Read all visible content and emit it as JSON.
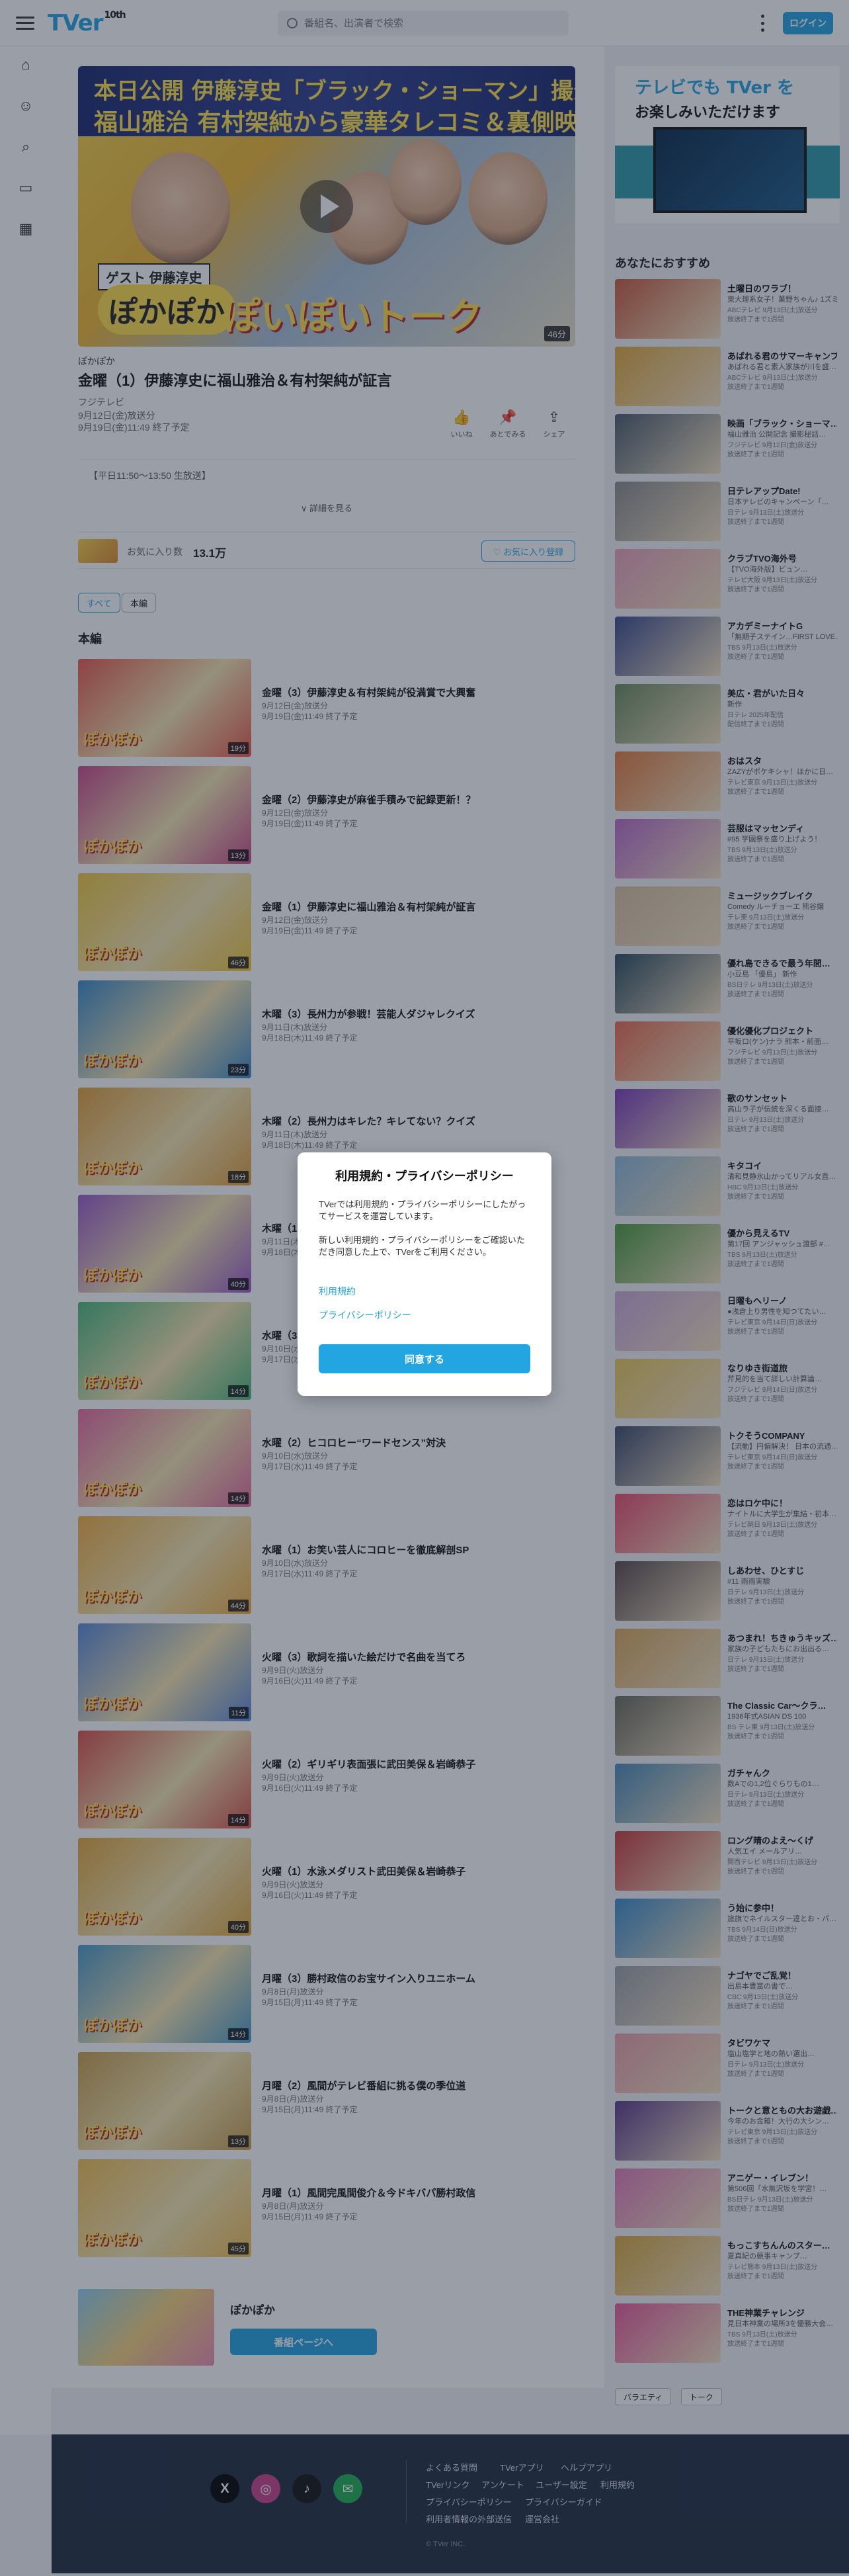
{
  "header": {
    "logo": "TVer",
    "logo_badge": "10th",
    "search_placeholder": "番組名、出演者で検索",
    "login_label": "ログイン"
  },
  "hero": {
    "line1": "本日公開 伊藤淳史「ブラック・ショーマン」撮影現場の裏側",
    "line2": "福山雅治 有村架純から豪華タレコミ＆裏側映SP",
    "guest_label": "ゲスト 伊藤淳史",
    "show_label": "ぽかぽか",
    "talk_label": "ぽいぽいトーク",
    "duration": "46分"
  },
  "episode": {
    "series": "ぽかぽか",
    "title": "金曜（1）伊藤淳史に福山雅治＆有村架純が証言",
    "broadcaster": "フジテレビ",
    "aired": "9月12日(金)放送分",
    "expires": "9月19日(金)11:49 終了予定",
    "actions": [
      {
        "icon": "thumb-icon",
        "glyph": "👍",
        "label": "いいね"
      },
      {
        "icon": "pin-icon",
        "glyph": "📌",
        "label": "あとでみる"
      },
      {
        "icon": "share-icon",
        "glyph": "⇪",
        "label": "シェア"
      }
    ],
    "description": "【平日11:50～13:50 生放送】",
    "more_label": "∨ 詳細を見る"
  },
  "favorite": {
    "label": "お気に入り数",
    "count": "13.1万",
    "button": "♡ お気に入り登録"
  },
  "filters": [
    "すべて",
    "本編"
  ],
  "section_title": "本編",
  "episodes": [
    {
      "title": "金曜（3）伊藤淳史＆有村架純が役満賞で大興奮",
      "aired": "9月12日(金)放送分",
      "expires": "9月19日(金)11:49 終了予定",
      "dur": "19分"
    },
    {
      "title": "金曜（2）伊藤淳史が麻雀手積みで記録更新！？",
      "aired": "9月12日(金)放送分",
      "expires": "9月19日(金)11:49 終了予定",
      "dur": "13分"
    },
    {
      "title": "金曜（1）伊藤淳史に福山雅治＆有村架純が証言",
      "aired": "9月12日(金)放送分",
      "expires": "9月19日(金)11:49 終了予定",
      "dur": "46分"
    },
    {
      "title": "木曜（3）長州力が参戦！芸能人ダジャレクイズ",
      "aired": "9月11日(木)放送分",
      "expires": "9月18日(木)11:49 終了予定",
      "dur": "23分"
    },
    {
      "title": "木曜（2）長州力はキレた？キレてない？クイズ",
      "aired": "9月11日(木)放送分",
      "expires": "9月18日(木)11:49 終了予定",
      "dur": "18分"
    },
    {
      "title": "木曜（1）",
      "aired": "9月11日(木)放送分",
      "expires": "9月18日(木)11:49 終了予定",
      "dur": "40分"
    },
    {
      "title": "水曜（3）",
      "aired": "9月10日(水)放送分",
      "expires": "9月17日(水)11:49 終了予定",
      "dur": "14分"
    },
    {
      "title": "水曜（2）ヒコロヒー“ワードセンス”対決",
      "aired": "9月10日(水)放送分",
      "expires": "9月17日(水)11:49 終了予定",
      "dur": "14分"
    },
    {
      "title": "水曜（1）お笑い芸人にコロヒーを徹底解剖SP",
      "aired": "9月10日(水)放送分",
      "expires": "9月17日(水)11:49 終了予定",
      "dur": "44分"
    },
    {
      "title": "火曜（3）歌詞を描いた絵だけで名曲を当てろ",
      "aired": "9月9日(火)放送分",
      "expires": "9月16日(火)11:49 終了予定",
      "dur": "11分"
    },
    {
      "title": "火曜（2）ギリギリ表面張に武田美保＆岩崎恭子",
      "aired": "9月9日(火)放送分",
      "expires": "9月16日(火)11:49 終了予定",
      "dur": "14分"
    },
    {
      "title": "火曜（1）水泳メダリスト武田美保＆岩崎恭子",
      "aired": "9月9日(火)放送分",
      "expires": "9月16日(火)11:49 終了予定",
      "dur": "40分"
    },
    {
      "title": "月曜（3）勝村政信のお宝サイン入りユニホーム",
      "aired": "9月8日(月)放送分",
      "expires": "9月15日(月)11:49 終了予定",
      "dur": "14分"
    },
    {
      "title": "月曜（2）風間がテレビ番組に挑る僕の季位道",
      "aired": "9月8日(月)放送分",
      "expires": "9月15日(月)11:49 終了予定",
      "dur": "13分"
    },
    {
      "title": "月曜（1）風間完風間俊介＆今ドキバパ勝村政信",
      "aired": "9月8日(月)放送分",
      "expires": "9月15日(月)11:49 終了予定",
      "dur": "45分"
    }
  ],
  "program": {
    "name": "ぽかぽか",
    "button": "番組ページへ"
  },
  "side": {
    "banner_line1": "テレビでも TVer を",
    "banner_line2": "お楽しみいただけます",
    "section_title": "あなたにおすすめ",
    "recommendations": [
      {
        "name": "土曜日のワラブ！",
        "sub": "東大理系女子！菓野ちゃん♪ 1ズミ…",
        "ch": "ABCテレビ 9月13日(土)放送分",
        "exp": "放送終了まで1週間",
        "c": "#c85a3a"
      },
      {
        "name": "あばれる君のサマーキャンプ",
        "sub": "あばれる君と素人家族が川を盛…",
        "ch": "ABCテレビ 9月13日(土)放送分",
        "exp": "放送終了まで1週間",
        "c": "#e0a83a"
      },
      {
        "name": "映画「ブラック・ショーマ…",
        "sub": "福山雅治 公開記念 撮影秘話…",
        "ch": "フジテレビ 9月12日(金)放送分",
        "exp": "放送終了まで1週間",
        "c": "#4a5a6a"
      },
      {
        "name": "日テレアップDate!",
        "sub": "日本テレビのキャンペーン「…",
        "ch": "日テレ 9月13日(土)放送分",
        "exp": "放送終了まで1週間",
        "c": "#8a8a8a"
      },
      {
        "name": "クラブTVO海外号",
        "sub": "【TVO海外版】ビュン…",
        "ch": "テレビ大阪 9月13日(土)放送分",
        "exp": "放送終了まで1週間",
        "c": "#e8a0b8"
      },
      {
        "name": "アカデミーナイトG",
        "sub": "「無期子ステイン…FIRST LOVE…",
        "ch": "TBS 9月13日(土)放送分",
        "exp": "放送終了まで1週間",
        "c": "#3a4a8a"
      },
      {
        "name": "美広・君がいた日々",
        "sub": "新作",
        "ch": "日テレ 2025年配信",
        "exp": "配信終了まで1週間",
        "c": "#6a8a5a"
      },
      {
        "name": "おはスタ",
        "sub": "ZAZYがポケキシャ！ほかに日…",
        "ch": "テレビ東京 9月13日(土)放送分",
        "exp": "放送終了まで1週間",
        "c": "#e07a3a"
      },
      {
        "name": "芸服はマッセンディ",
        "sub": "#95 学園祭を盛り上げよう！",
        "ch": "TBS 9月13日(土)放送分",
        "exp": "放送終了まで1週間",
        "c": "#b86ac8"
      },
      {
        "name": "ミュージックブレイク",
        "sub": "Comedy ルーチョーエ 熊谷嬢",
        "ch": "テレ東 9月13日(土)放送分",
        "exp": "放送終了まで1週間",
        "c": "#d8c0a0"
      },
      {
        "name": "優れ島できるで最う年間…",
        "sub": "小豆島 「優島」 新作",
        "ch": "BS日テレ 9月13日(土)放送分",
        "exp": "放送終了まで1週間",
        "c": "#2a4a5a"
      },
      {
        "name": "優化優化プロジェクト",
        "sub": "平坂ロ(ケン)ナラ 熊本・前面…",
        "ch": "フジテレビ 9月13日(土)放送分",
        "exp": "放送終了まで1週間",
        "c": "#e86a4a"
      },
      {
        "name": "歌のサンセット",
        "sub": "高山ラ子が伝統を深くる面接…",
        "ch": "日テレ 9月13日(土)放送分",
        "exp": "放送終了まで1週間",
        "c": "#7a3ab8"
      },
      {
        "name": "キタコイ",
        "sub": "清和見静氷山かってリアル女直…",
        "ch": "HBC 9月13日(土)放送分",
        "exp": "放送終了まで1週間",
        "c": "#8ab8d8"
      },
      {
        "name": "優から見えるTV",
        "sub": "第17回 アンジャッシュ渡部 #…",
        "ch": "TBS 9月13日(土)放送分",
        "exp": "放送終了まで1週間",
        "c": "#4a9a3a"
      },
      {
        "name": "日曜もヘリーノ",
        "sub": "●浅倉上り男性を知つてたい…",
        "ch": "テレビ東京 9月14日(日)放送分",
        "exp": "放送終了まで1週間",
        "c": "#c8a8d8"
      },
      {
        "name": "なりゆき街道旅",
        "sub": "芹見的を当て詳しい計算論…",
        "ch": "フジテレビ 9月14日(日)放送分",
        "exp": "放送終了まで1週間",
        "c": "#e8c85a"
      },
      {
        "name": "トクそうCOMPANY",
        "sub": "【流動】円偏解決！ 日本の流通…",
        "ch": "テレビ東京 9月14日(日)放送分",
        "exp": "放送終了まで1週間",
        "c": "#3a4a6a"
      },
      {
        "name": "恋はロケ中に！",
        "sub": "ナイトルに大学生が集結・初本…",
        "ch": "テレビ朝日 9月13日(土)放送分",
        "exp": "放送終了まで1週間",
        "c": "#e84a6a"
      },
      {
        "name": "しあわせ、ひとすじ",
        "sub": "#11 雨雨実験",
        "ch": "日テレ 9月13日(土)放送分",
        "exp": "放送終了まで1週間",
        "c": "#5a4a4a"
      },
      {
        "name": "あつまれ！ちきゅうキッズ…",
        "sub": "家族の子どもたちにお出出る…",
        "ch": "日テレ 9月13日(土)放送分",
        "exp": "放送終了まで1週間",
        "c": "#d8a85a"
      },
      {
        "name": "The Classic Car〜クラ…",
        "sub": "1936年式ASIAN DS 100",
        "ch": "BS テレ東 9月13日(土)放送分",
        "exp": "放送終了まで1週間",
        "c": "#6a6a5a"
      },
      {
        "name": "ガチャんク",
        "sub": "数Aでの1,2位ぐらりもの1…",
        "ch": "日テレ 9月13日(土)放送分",
        "exp": "放送終了まで1週間",
        "c": "#4a8ab8"
      },
      {
        "name": "ロング晴のよえ〜くげ",
        "sub": "人気エイ メールアリ…",
        "ch": "関西テレビ 9月13日(土)放送分",
        "exp": "放送終了まで1週間",
        "c": "#c83a3a"
      },
      {
        "name": "う始に参中！",
        "sub": "旅旗でネイルスター達とお・パ…",
        "ch": "TBS 9月14日(日)放送分",
        "exp": "放送終了まで1週間",
        "c": "#3a8ac8"
      },
      {
        "name": "ナゴヤでご乱覚！",
        "sub": "出島本豊富の書で…",
        "ch": "CBC 9月13日(土)放送分",
        "exp": "放送終了まで1週間",
        "c": "#9aa0a8"
      },
      {
        "name": "タビワケマ",
        "sub": "塩山塩学と地の熱い選出…",
        "ch": "日テレ 9月13日(土)放送分",
        "exp": "放送終了まで1週間",
        "c": "#e8a0a8"
      },
      {
        "name": "トークと意ともの大お遊戯…",
        "sub": "今年のお金箱！大行の大シン…",
        "ch": "テレビ東京 9月13日(土)放送分",
        "exp": "放送終了まで1週間",
        "c": "#5a3a8a"
      },
      {
        "name": "アニゲー・イレブン！",
        "sub": "第506回「水無沢坂を学宮！…",
        "ch": "BS日テレ 9月13日(土)放送分",
        "exp": "放送終了まで1週間",
        "c": "#e07ab8"
      },
      {
        "name": "もっこすちんんのスター…",
        "sub": "夏真紀の競事キャンプ…",
        "ch": "テレビ熊本 9月13日(土)放送分",
        "exp": "放送終了まで1週間",
        "c": "#d8a83a"
      },
      {
        "name": "THE神業チャレンジ",
        "sub": "見日本神業の場所3を優勝大会…",
        "ch": "TBS 9月13日(土)放送分",
        "exp": "放送終了まで1週間",
        "c": "#e85a9a"
      }
    ],
    "tags": [
      "バラエティ",
      "トーク"
    ]
  },
  "footer": {
    "links": [
      "よくある質問",
      "TVerアプリ",
      "ヘルプアプリ",
      "TVerリンク",
      "アンケート",
      "ユーザー設定",
      "利用規約",
      "プライバシーポリシー",
      "プライバシーガイド",
      "利用者情報の外部送信",
      "運営会社"
    ],
    "copyright": "© TVer INC."
  },
  "modal": {
    "title": "利用規約・プライバシーポリシー",
    "p1": "TVerでは利用規約・プライバシーポリシーにしたがってサービスを運営しています。",
    "p2": "新しい利用規約・プライバシーポリシーをご確認いただき同意した上で、TVerをご利用ください。",
    "terms_link": "利用規約",
    "privacy_link": "プライバシーポリシー",
    "agree_button": "同意する"
  },
  "colors": {
    "accent": "#22a5e0",
    "footer": "#1f2c3f"
  }
}
